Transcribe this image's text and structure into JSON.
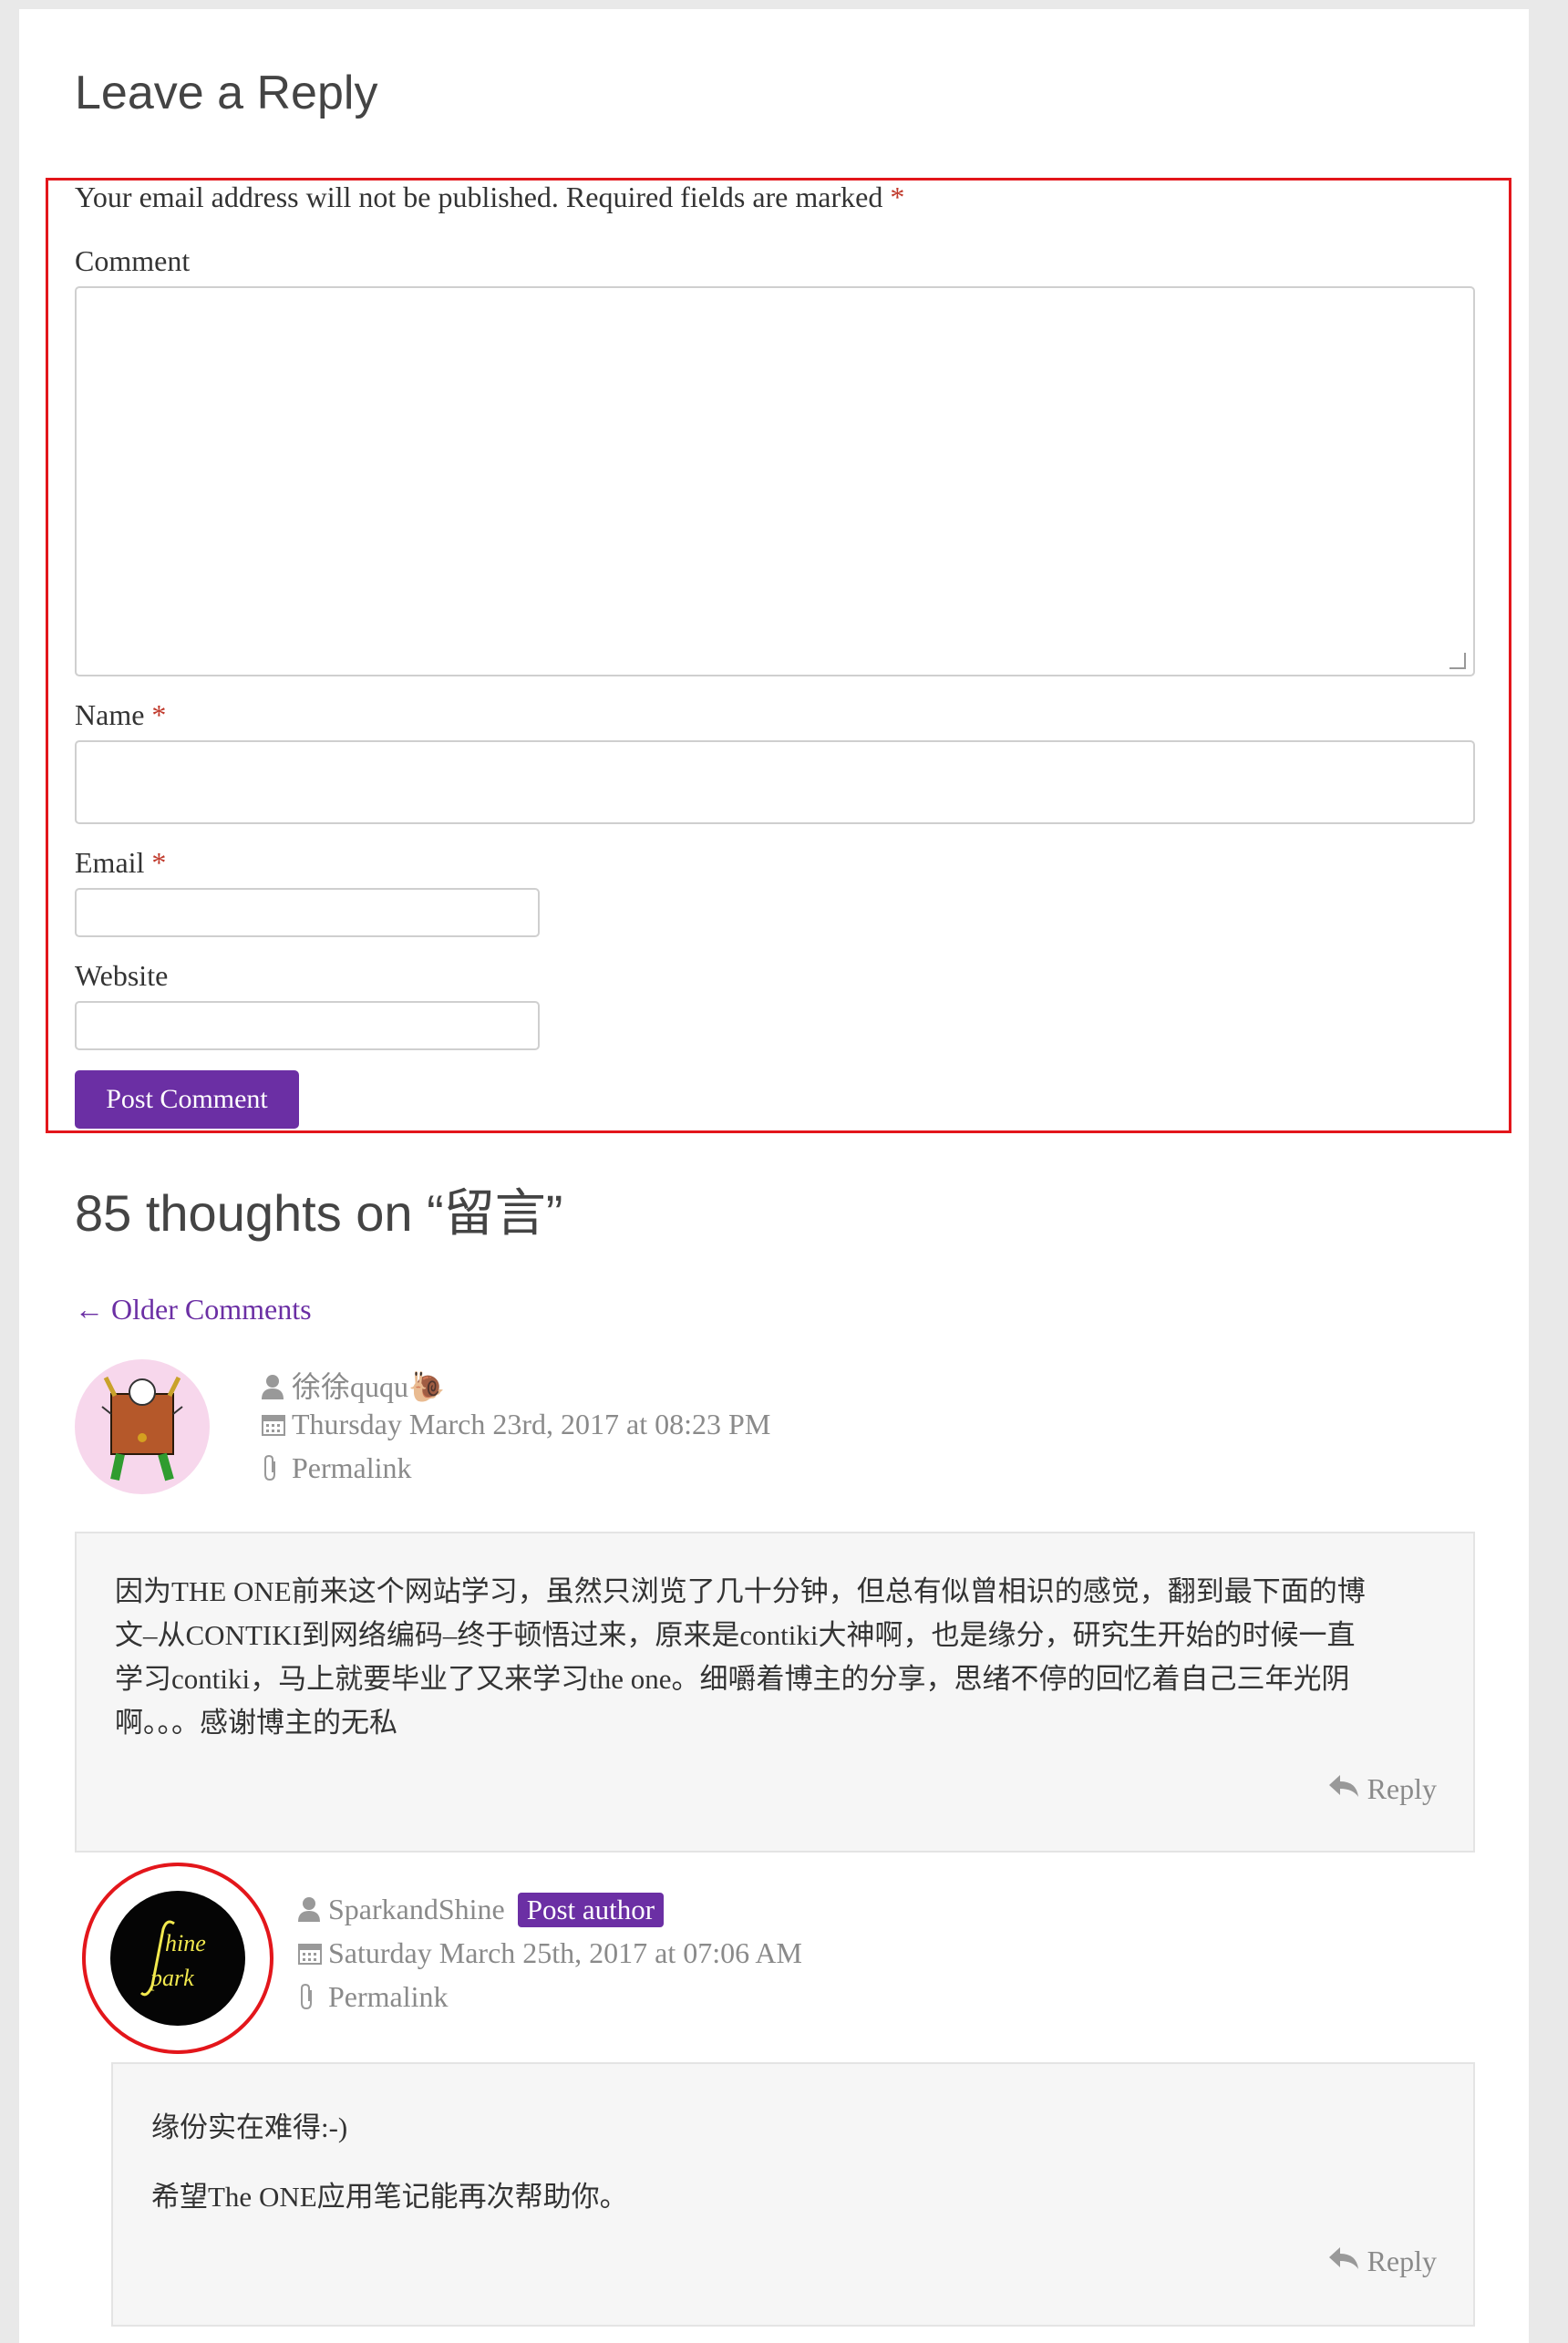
{
  "reply_section": {
    "title": "Leave a Reply",
    "notes": "Your email address will not be published. Required fields are marked",
    "required_mark": "*",
    "comment_label": "Comment",
    "name_label": "Name",
    "email_label": "Email",
    "website_label": "Website",
    "comment_value": "",
    "name_value": "",
    "email_value": "",
    "website_value": "",
    "submit_label": "Post Comment"
  },
  "comments_section": {
    "title": "85 thoughts on “留言”",
    "older_link": "← Older Comments",
    "comments": [
      {
        "author": "徐徐ququ🐌",
        "date": "Thursday March 23rd, 2017 at 08:23 PM",
        "permalink": "Permalink",
        "body_lines": [
          "因为THE ONE前来这个网站学习，虽然只浏览了几十分钟，但总有似曾相识的感觉，翻到最下面的博",
          "文–从CONTIKI到网络编码–终于顿悟过来，原来是contiki大神啊，也是缘分，研究生开始的时候一直",
          "学习contiki，马上就要毕业了又来学习the one。细嚼着博主的分享，思绪不停的回忆着自己三年光阴",
          "啊。。。感谢博主的无私"
        ],
        "reply_label": "Reply"
      },
      {
        "author": "SparkandShine",
        "badge": "Post author",
        "date": "Saturday March 25th, 2017 at 07:06 AM",
        "permalink": "Permalink",
        "body_lines": [
          "缘份实在难得:-)",
          "希望The ONE应用笔记能再次帮助你。"
        ],
        "reply_label": "Reply",
        "avatar_text_top": "hine",
        "avatar_text_bottom": "park"
      }
    ]
  },
  "colors": {
    "accent": "#6b2fa4",
    "highlight": "#e3161b",
    "meta_text": "#8a8a8a",
    "comment_bg": "#f6f6f6"
  },
  "icons": [
    "user-icon",
    "calendar-icon",
    "paperclip-icon",
    "reply-arrow-icon",
    "snail-icon"
  ]
}
